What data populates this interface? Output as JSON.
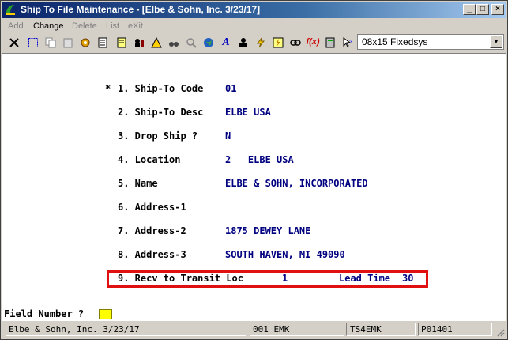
{
  "window": {
    "title": "Ship To File Maintenance - [Elbe & Sohn, Inc. 3/23/17]"
  },
  "titlebar_buttons": {
    "minimize": "_",
    "maximize": "□",
    "close": "×"
  },
  "menu": [
    {
      "label": "Add",
      "enabled": false
    },
    {
      "label": "Change",
      "enabled": true
    },
    {
      "label": "Delete",
      "enabled": false
    },
    {
      "label": "List",
      "enabled": false
    },
    {
      "label": "eXit",
      "enabled": false
    }
  ],
  "toolbar": {
    "icons": [
      "close-x-icon",
      "select-icon",
      "copy-icon",
      "paste-icon",
      "gear-icon",
      "notepad-icon",
      "contacts-icon",
      "alert-icon",
      "binoculars-icon",
      "magnifier-icon",
      "globe-icon",
      "font-icon",
      "user-icon",
      "lightning-icon",
      "lightning-box-icon",
      "link-icon",
      "function-icon",
      "calculator-icon",
      "help-pointer-icon"
    ],
    "font_select": "08x15 Fixedsys"
  },
  "fields": [
    {
      "marker": "*",
      "label": "1. Ship-To Code",
      "value": "01"
    },
    {
      "marker": "",
      "label": "2. Ship-To Desc",
      "value": "ELBE USA"
    },
    {
      "marker": "",
      "label": "3. Drop Ship ?",
      "value": "N"
    },
    {
      "marker": "",
      "label": "4. Location",
      "value": "2   ELBE USA"
    },
    {
      "marker": "",
      "label": "5. Name",
      "value": "ELBE & SOHN, INCORPORATED"
    },
    {
      "marker": "",
      "label": "6. Address-1",
      "value": ""
    },
    {
      "marker": "",
      "label": "7. Address-2",
      "value": "1875 DEWEY LANE"
    },
    {
      "marker": "",
      "label": "8. Address-3",
      "value": "SOUTH HAVEN, MI 49090"
    }
  ],
  "field9": {
    "label": "9. Recv to Transit Loc",
    "value": "1",
    "lead_label": "Lead Time",
    "lead_value": "30"
  },
  "prompt": {
    "label": "Field Number ?"
  },
  "status": {
    "company": "Elbe & Sohn, Inc. 3/23/17",
    "user": "001 EMK",
    "terminal": "TS4EMK",
    "program": "P01401"
  },
  "colors": {
    "highlight": "#e01010",
    "value_text": "#000080",
    "titlebar": "#0a246a",
    "cursor": "#ffff00"
  }
}
